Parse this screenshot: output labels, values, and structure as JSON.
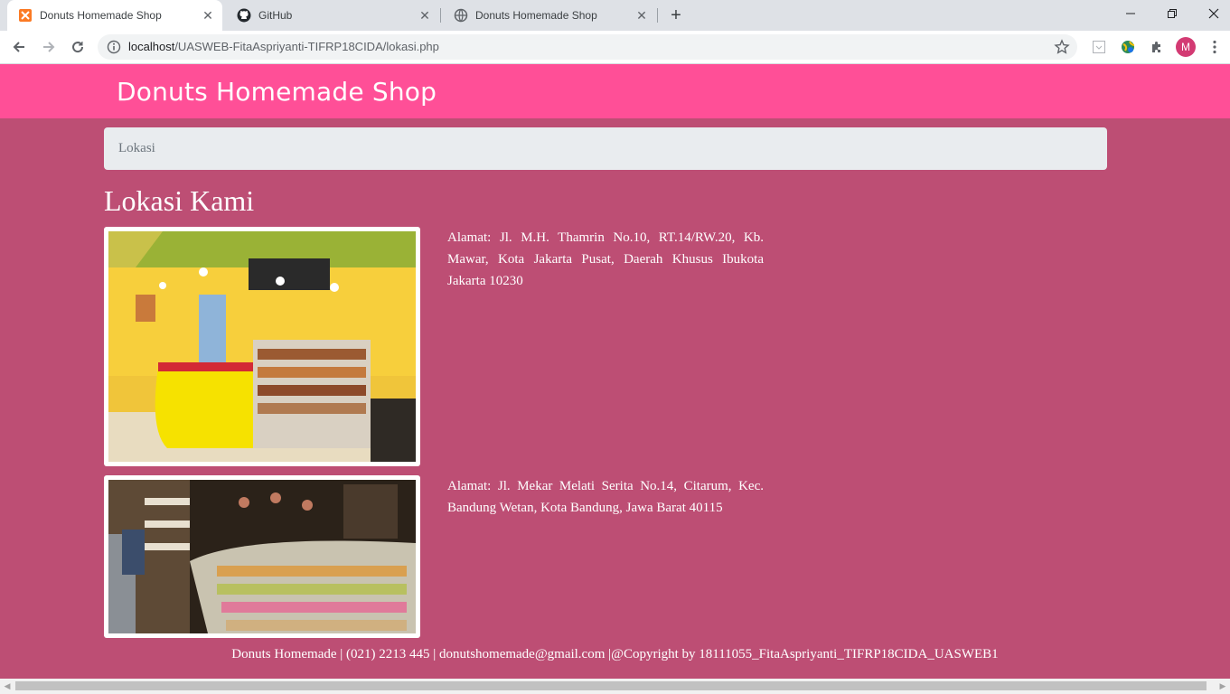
{
  "browser": {
    "tabs": [
      {
        "title": "Donuts Homemade Shop",
        "icon": "xampp-icon",
        "active": true
      },
      {
        "title": "GitHub",
        "icon": "github-icon",
        "active": false
      },
      {
        "title": "Donuts Homemade Shop",
        "icon": "globe-icon",
        "active": false
      }
    ],
    "close_glyph": "✕",
    "new_tab_glyph": "+",
    "url_host": "localhost",
    "url_path": "/UASWEB-FitaAspriyanti-TIFRP18CIDA/lokasi.php",
    "profile_initial": "M"
  },
  "site": {
    "brand": "Donuts Homemade Shop",
    "breadcrumb": "Lokasi",
    "page_title": "Lokasi Kami",
    "locations": [
      {
        "address": "Alamat: Jl. M.H. Thamrin No.10, RT.14/RW.20, Kb. Mawar, Kota Jakarta Pusat, Daerah Khusus Ibukota Jakarta 10230",
        "photo": "yellow-donut-shop-interior"
      },
      {
        "address": "Alamat: Jl. Mekar Melati Serita No.14, Citarum, Kec. Bandung Wetan, Kota Bandung, Jawa Barat 40115",
        "photo": "donut-display-counter"
      }
    ],
    "footer": "Donuts Homemade | (021) 2213 445 | donutshomemade@gmail.com |@Copyright by 18111055_FitaAspriyanti_TIFRP18CIDA_UASWEB1"
  },
  "colors": {
    "header": "#ff4f97",
    "page_bg": "#bd4e74",
    "breadcrumb_bg": "#e9ecef"
  }
}
